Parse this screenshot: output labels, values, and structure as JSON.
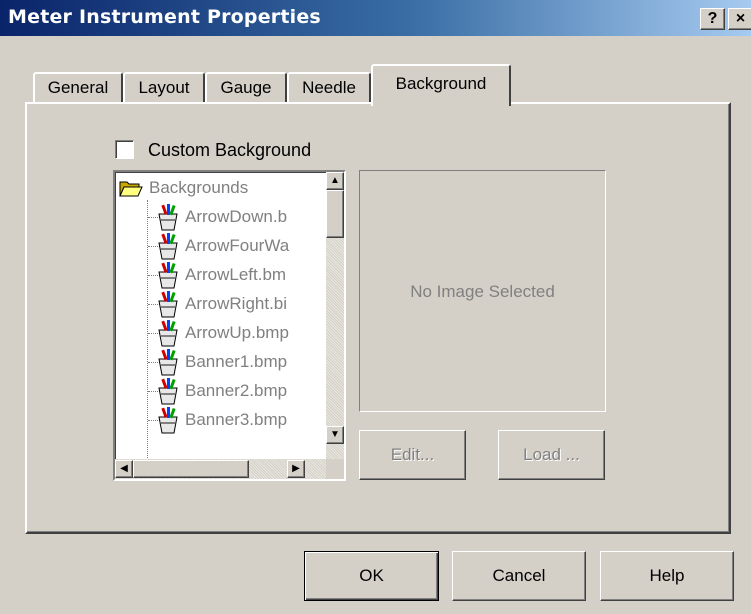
{
  "window": {
    "title": "Meter Instrument Properties",
    "help_label": "?",
    "close_label": "×"
  },
  "tabs": [
    {
      "label": "General",
      "active": false
    },
    {
      "label": "Layout",
      "active": false
    },
    {
      "label": "Gauge",
      "active": false
    },
    {
      "label": "Needle",
      "active": false
    },
    {
      "label": "Background",
      "active": true
    }
  ],
  "background_tab": {
    "custom_background": {
      "label": "Custom Background",
      "checked": false
    },
    "tree": {
      "root": {
        "label": "Backgrounds",
        "icon": "folder-open-icon"
      },
      "items": [
        {
          "label": "ArrowDown.b",
          "icon": "bitmap-file-icon"
        },
        {
          "label": "ArrowFourWa",
          "icon": "bitmap-file-icon"
        },
        {
          "label": "ArrowLeft.bm",
          "icon": "bitmap-file-icon"
        },
        {
          "label": "ArrowRight.bi",
          "icon": "bitmap-file-icon"
        },
        {
          "label": "ArrowUp.bmp",
          "icon": "bitmap-file-icon"
        },
        {
          "label": "Banner1.bmp",
          "icon": "bitmap-file-icon"
        },
        {
          "label": "Banner2.bmp",
          "icon": "bitmap-file-icon"
        },
        {
          "label": "Banner3.bmp",
          "icon": "bitmap-file-icon"
        }
      ],
      "disabled": true
    },
    "preview": {
      "text": "No Image Selected"
    },
    "edit_button": {
      "label": "Edit...",
      "disabled": true
    },
    "load_button": {
      "label": "Load ...",
      "disabled": true
    }
  },
  "footer": {
    "ok_label": "OK",
    "cancel_label": "Cancel",
    "help_label": "Help"
  },
  "colors": {
    "face": "#d4d0c8",
    "title_start": "#0a246a",
    "title_end": "#a6caf0",
    "disabled_text": "#808080"
  }
}
